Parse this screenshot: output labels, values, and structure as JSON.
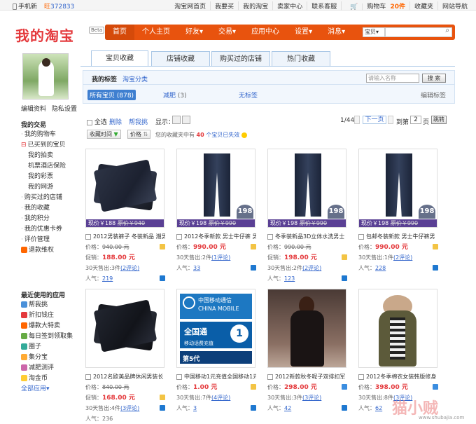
{
  "topbar": {
    "mobile": "手机新",
    "wangwang": "372833",
    "links": [
      "淘宝网首页",
      "我要买",
      "我的淘宝",
      "卖家中心",
      "联系客服",
      "购物车",
      "收藏夹",
      "网站导航"
    ],
    "cart_count": "20件",
    "cart_prefix": "购物车"
  },
  "logo": {
    "text": "我的淘宝",
    "beta": "Beta"
  },
  "mainnav": {
    "items": [
      "首页",
      "个人主页",
      "好友",
      "交易",
      "应用中心",
      "设置",
      "消息"
    ],
    "search_select": "宝贝",
    "search_placeholder": ""
  },
  "profile": {
    "edit": "编辑资料",
    "privacy": "隐私设置"
  },
  "sidebar": {
    "my_trade_title": "我的交易",
    "items": [
      "我的购物车",
      "已买到的宝贝",
      "我的拍卖",
      "机票酒店保险",
      "我的彩票",
      "我的网游",
      "购买过的店铺",
      "我的收藏",
      "我的积分",
      "我的优惠卡券",
      "评价管理",
      "退款维权"
    ],
    "recent_title": "最近使用的应用",
    "apps": [
      "帮我挑",
      "折扣钱庄",
      "爆款大特卖",
      "每日签到领取集",
      "圈子",
      "集分宝",
      "减肥测评",
      "淘金币"
    ],
    "all_apps": "全部应用"
  },
  "tabs": [
    "宝贝收藏",
    "店铺收藏",
    "购买过的店铺",
    "热门收藏"
  ],
  "filter": {
    "my_tags": "我的标签",
    "taobao_cat": "淘宝分类",
    "search_placeholder": "请输入名称",
    "search_btn": "搜 索",
    "all": "所有宝贝 (878)",
    "drop": "减肥",
    "drop_count": "(3)",
    "untagged": "无标签",
    "edit_tags": "编辑标签"
  },
  "toolbar": {
    "select_all": "全选",
    "delete": "删除",
    "find": "帮我挑",
    "display": "显示：",
    "page": "1/44",
    "next": "下一页",
    "goto": "到第",
    "page_input": "2",
    "page_unit": "页",
    "jump": "跳转"
  },
  "sort": {
    "time": "收藏时间",
    "price": "价格",
    "msg_pre": "您的收藏夹中有",
    "msg_num": "40",
    "msg_post": "个宝贝已失效"
  },
  "products": [
    {
      "title": "2012男装裤子 冬装新品 潮男",
      "price_label": "价格：",
      "price": "940.00 元",
      "promo_label": "促销：",
      "promo": "188.00 元",
      "sold": "30天售出:3件",
      "reviews": "(2评论)",
      "pop_label": "人气：",
      "pop": "219",
      "bar_now": "现价￥188",
      "bar_old": "原价￥940"
    },
    {
      "title": "2012冬季新款 男士牛仔裤 男",
      "price_label": "价格：",
      "price": "990.00 元",
      "promo_label": "",
      "promo": "",
      "sold": "30天售出:2件",
      "reviews": "(1评论)",
      "pop_label": "人气：",
      "pop": "33",
      "bar_now": "现价￥198",
      "bar_old": "原价￥990",
      "badge": "198"
    },
    {
      "title": "冬季装新品3D立体水洗男士",
      "price_label": "价格：",
      "price": "990.00 元",
      "promo_label": "促销：",
      "promo": "198.00 元",
      "sold": "30天售出:2件",
      "reviews": "(2评论)",
      "pop_label": "人气：",
      "pop": "123",
      "bar_now": "现价￥198",
      "bar_old": "原价￥990",
      "badge": "198"
    },
    {
      "title": "包邮冬装新款 男士牛仔裤男",
      "price_label": "价格：",
      "price": "990.00 元",
      "promo_label": "",
      "promo": "",
      "sold": "30天售出:1件",
      "reviews": "(2评论)",
      "pop_label": "人气：",
      "pop": "228",
      "bar_now": "现价￥198",
      "bar_old": "原价￥990",
      "badge": "198"
    },
    {
      "title": "2012名欧美品牌休闲男装长",
      "price_label": "价格：",
      "price": "840.00 元",
      "promo_label": "促销：",
      "promo": "168.00 元",
      "sold": "30天售出:4件",
      "reviews": "(3评论)",
      "pop_label": "人气：",
      "pop": "236"
    },
    {
      "title": "中国移动1元充值全国移动1元",
      "price_label": "价格：",
      "price": "1.00 元",
      "promo_label": "",
      "promo": "",
      "sold": "30天售出:7件",
      "reviews": "(4评论)",
      "pop_label": "人气：",
      "pop": "3",
      "img_top": "中国移动通信 CHINA MOBILE",
      "img_mid": "全国通",
      "img_sub": "移动话费充值",
      "img_num": "1",
      "img_bot": "第5代"
    },
    {
      "title": "2012新款秋冬呢子双排扣军",
      "price_label": "价格：",
      "price": "298.00 元",
      "promo_label": "",
      "promo": "",
      "sold": "30天售出:3件",
      "reviews": "(3评论)",
      "pop_label": "人气：",
      "pop": "42"
    },
    {
      "title": "2012冬季棉衣女装韩版修身",
      "price_label": "价格：",
      "price": "398.00 元",
      "promo_label": "",
      "promo": "",
      "sold": "30天售出:8件",
      "reviews": "(3评论)",
      "pop_label": "人气：",
      "pop": "62"
    }
  ],
  "watermark": {
    "text": "猫小贼",
    "url": "www.shubajia.com"
  },
  "colors": {
    "brand": "#e4393c",
    "nav": "#e8530e",
    "link": "#3366cc",
    "price_bar": "#5a4094"
  }
}
